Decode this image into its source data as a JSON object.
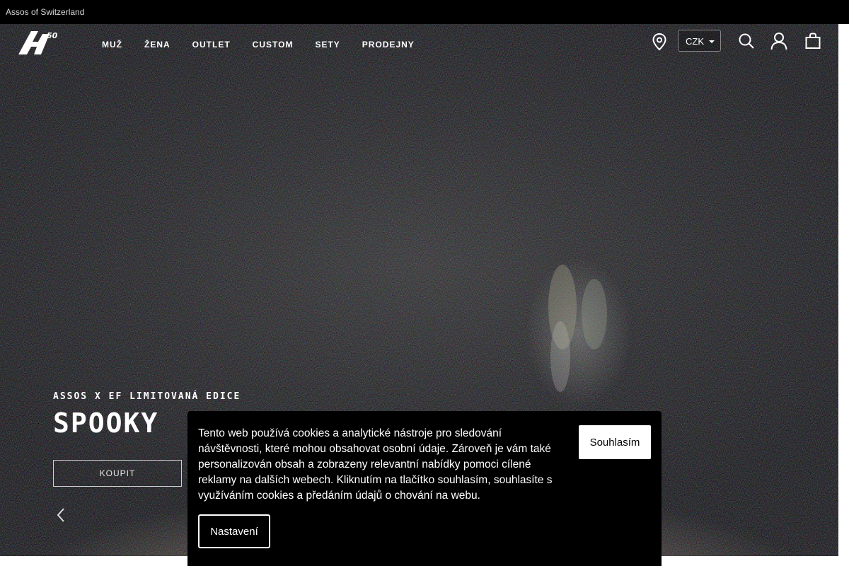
{
  "topbar": {
    "brand_text": "Assos of Switzerland"
  },
  "header": {
    "logo_icon": "assos-50-logo-icon",
    "nav": [
      {
        "label": "MUŽ"
      },
      {
        "label": "ŽENA"
      },
      {
        "label": "OUTLET"
      },
      {
        "label": "CUSTOM"
      },
      {
        "label": "SETY"
      },
      {
        "label": "PRODEJNY"
      }
    ],
    "currency": "CZK",
    "icons": [
      "location-pin-icon",
      "search-icon",
      "user-icon",
      "shopping-bag-icon"
    ]
  },
  "hero": {
    "eyebrow": "ASSOS X EF LIMITOVANÁ EDICE",
    "headline": "SPOOKY",
    "cta": "KOUPIT"
  },
  "cookie_banner": {
    "text": "Tento web používá cookies a analytické nástroje pro sledování návštěvnosti, které mohou obsahovat osobní údaje. Zároveň je vám také personalizován obsah a zobrazeny relevantní nabídky pomoci cílené reklamy na dalších webech. Kliknutím na tlačítko souhlasím, souhlasíte s využíváním cookies a předáním údajů o chování na webu.",
    "accept_label": "Souhlasím",
    "settings_label": "Nastavení"
  },
  "colors": {
    "background": "#000000",
    "text": "#ffffff",
    "accept_button": "#ffffff"
  }
}
